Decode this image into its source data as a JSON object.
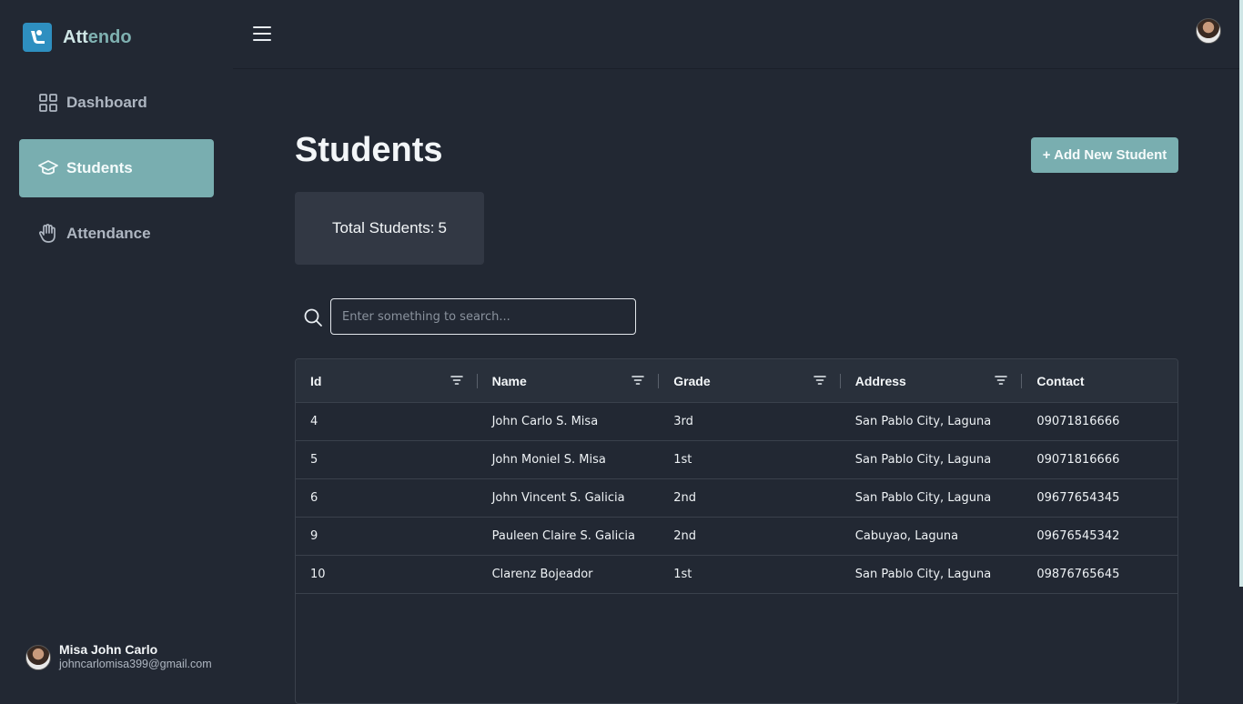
{
  "brand": {
    "name_part1": "Att",
    "name_part2": "endo",
    "logo_color": "#2e8fc0"
  },
  "sidebar": {
    "items": [
      {
        "label": "Dashboard",
        "icon": "grid-icon",
        "active": false
      },
      {
        "label": "Students",
        "icon": "graduation-cap-icon",
        "active": true
      },
      {
        "label": "Attendance",
        "icon": "hand-icon",
        "active": false
      }
    ],
    "user": {
      "name": "Misa John Carlo",
      "email": "johncarlomisa399@gmail.com"
    }
  },
  "colors": {
    "accent": "#79aeb0",
    "background": "#222833",
    "card": "#323844"
  },
  "page": {
    "title": "Students",
    "add_button": "+ Add New Student",
    "total_label": "Total Students:",
    "total_value": "5"
  },
  "search": {
    "placeholder": "Enter something to search..."
  },
  "table": {
    "columns": [
      "Id",
      "Name",
      "Grade",
      "Address",
      "Contact"
    ],
    "rows": [
      [
        "4",
        "John Carlo S. Misa",
        "3rd",
        "San Pablo City, Laguna",
        "09071816666"
      ],
      [
        "5",
        "John Moniel S. Misa",
        "1st",
        "San Pablo City, Laguna",
        "09071816666"
      ],
      [
        "6",
        "John Vincent S. Galicia",
        "2nd",
        "San Pablo City, Laguna",
        "09677654345"
      ],
      [
        "9",
        "Pauleen Claire S. Galicia",
        "2nd",
        "Cabuyao, Laguna",
        "09676545342"
      ],
      [
        "10",
        "Clarenz Bojeador",
        "1st",
        "San Pablo City, Laguna",
        "09876765645"
      ]
    ]
  }
}
